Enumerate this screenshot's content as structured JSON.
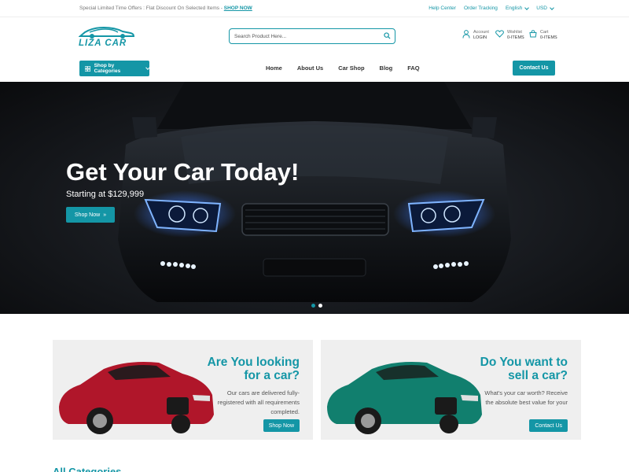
{
  "topbar": {
    "promo_text": "Special Limited Time Offers : Flat Discount On Selected Items - ",
    "promo_link": "SHOP NOW",
    "help": "Help Center",
    "tracking": "Order Tracking",
    "language": "English",
    "currency": "USD"
  },
  "header": {
    "logo_text": "LIZA CAR",
    "search_placeholder": "Search Product Here...",
    "account_label": "Account",
    "account_sub": "LOGIN",
    "wishlist_label": "Wishlist",
    "wishlist_sub": "0-ITEMS",
    "cart_label": "Cart",
    "cart_sub": "0-ITEMS"
  },
  "nav": {
    "categories_label": "Shop by Categories",
    "items": [
      "Home",
      "About Us",
      "Car Shop",
      "Blog",
      "FAQ"
    ],
    "contact_label": "Contact Us"
  },
  "hero": {
    "title": "Get Your Car Today!",
    "subtitle": "Starting at $129,999",
    "button": "Shop Now",
    "slides": 2,
    "active_slide": 1
  },
  "cards": [
    {
      "title": "Are You looking for a car?",
      "description": "Our cars are delivered fully-registered with all requirements completed.",
      "button": "Shop Now",
      "car_color": "#b0162a"
    },
    {
      "title": "Do You want to sell a car?",
      "description": "What's your car worth? Receive the absolute best value for your",
      "button": "Contact Us",
      "car_color": "#117f6e"
    }
  ],
  "section": {
    "title": "All Categories"
  },
  "colors": {
    "accent": "#1496a6"
  }
}
